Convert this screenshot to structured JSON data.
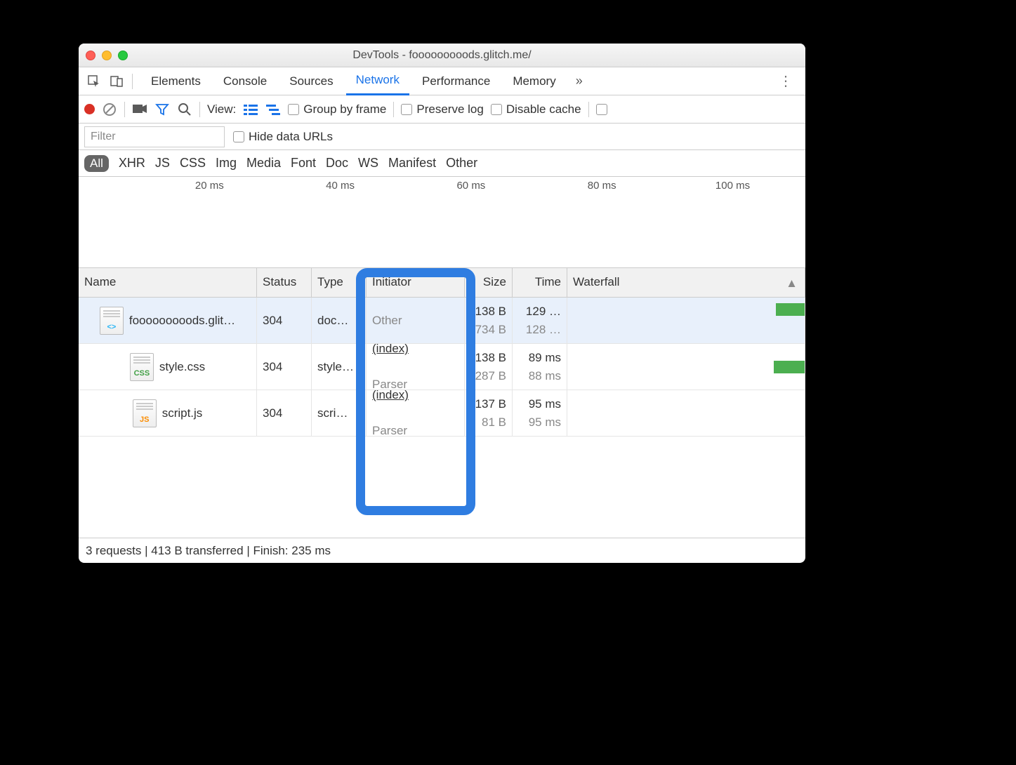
{
  "window": {
    "title": "DevTools - fooooooooods.glitch.me/"
  },
  "tabs": {
    "items": [
      "Elements",
      "Console",
      "Sources",
      "Network",
      "Performance",
      "Memory"
    ],
    "active_index": 3,
    "overflow_glyph": "»"
  },
  "toolbar": {
    "view_label": "View:",
    "group_by_frame": "Group by frame",
    "preserve_log": "Preserve log",
    "disable_cache": "Disable cache"
  },
  "filter": {
    "placeholder": "Filter",
    "hide_data_urls": "Hide data URLs"
  },
  "type_filters": [
    "All",
    "XHR",
    "JS",
    "CSS",
    "Img",
    "Media",
    "Font",
    "Doc",
    "WS",
    "Manifest",
    "Other"
  ],
  "timeline": {
    "ticks": [
      "20 ms",
      "40 ms",
      "60 ms",
      "80 ms",
      "100 ms"
    ]
  },
  "columns": {
    "name": "Name",
    "status": "Status",
    "type": "Type",
    "initiator": "Initiator",
    "size": "Size",
    "time": "Time",
    "waterfall": "Waterfall"
  },
  "rows": [
    {
      "name": "fooooooooods.glit…",
      "icon": "html",
      "status": "304",
      "type": "doc…",
      "initiator_top": "Other",
      "initiator_sub": "",
      "size_top": "138 B",
      "size_sub": "734 B",
      "time_top": "129 …",
      "time_sub": "128 …",
      "bar_left_pct": 88,
      "bar_width_pct": 12,
      "selected": true
    },
    {
      "name": "style.css",
      "icon": "css",
      "status": "304",
      "type": "style…",
      "initiator_top": "(index)",
      "initiator_sub": "Parser",
      "initiator_link": true,
      "size_top": "138 B",
      "size_sub": "287 B",
      "time_top": "89 ms",
      "time_sub": "88 ms",
      "bar_left_pct": 87,
      "bar_width_pct": 13
    },
    {
      "name": "script.js",
      "icon": "js",
      "status": "304",
      "type": "scri…",
      "initiator_top": "(index)",
      "initiator_sub": "Parser",
      "initiator_link": true,
      "size_top": "137 B",
      "size_sub": "81 B",
      "time_top": "95 ms",
      "time_sub": "95 ms",
      "bar_left_pct": 100,
      "bar_width_pct": 0
    }
  ],
  "footer": {
    "text": "3 requests | 413 B transferred | Finish: 235 ms"
  },
  "sort_arrow": "▲"
}
